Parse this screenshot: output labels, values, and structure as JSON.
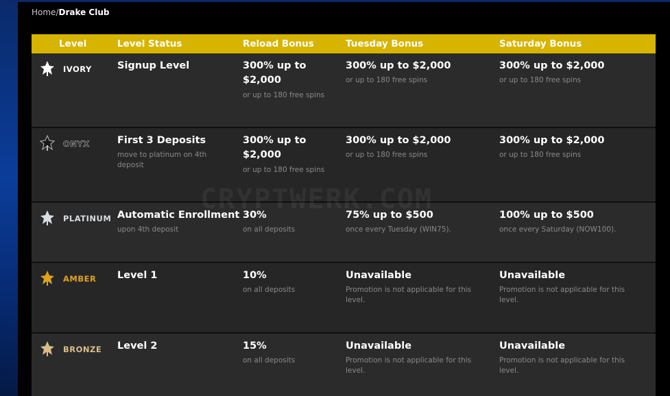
{
  "breadcrumb": {
    "home": "Home",
    "separator": "/",
    "current": "Drake Club"
  },
  "table": {
    "headers": [
      "Level",
      "Level Status",
      "Reload Bonus",
      "Tuesday Bonus",
      "Saturday Bonus"
    ],
    "rows": [
      {
        "level": "IVORY",
        "level_color": "#ffffff",
        "status": "Signup Level",
        "status_note": "",
        "reload": "300% up to\n$2,000",
        "reload_note": "or up to 180 free spins",
        "tuesday": "300% up to $2,000",
        "tuesday_note": "or up to 180 free spins",
        "saturday": "300% up to $2,000",
        "saturday_note": "or up to 180 free spins"
      },
      {
        "level": "ONYX",
        "level_color": "#1a1a1a",
        "status": "First 3 Deposits",
        "status_note": "move to platinum on 4th\ndeposit",
        "reload": "300% up to\n$2,000",
        "reload_note": "or up to 180 free spins",
        "tuesday": "300% up to $2,000",
        "tuesday_note": "or up to 180 free spins",
        "saturday": "300% up to $2,000",
        "saturday_note": "or up to 180 free spins"
      },
      {
        "level": "PLATINUM",
        "level_color": "#d9dde3",
        "status": "Automatic Enrollment",
        "status_note": "upon 4th deposit",
        "reload": "30%",
        "reload_note": "on all deposits",
        "tuesday": "75% up to $500",
        "tuesday_note": "once every Tuesday (WIN75).",
        "saturday": "100% up to $500",
        "saturday_note": "once every Saturday (NOW100)."
      },
      {
        "level": "AMBER",
        "level_color": "#e0a21a",
        "status": "Level 1",
        "status_note": "",
        "reload": "10%",
        "reload_note": "on all deposits",
        "tuesday": "Unavailable",
        "tuesday_note": "Promotion is not applicable for this\nlevel.",
        "saturday": "Unavailable",
        "saturday_note": "Promotion is not applicable for this\nlevel."
      },
      {
        "level": "BRONZE",
        "level_color": "#d8bd8a",
        "status": "Level 2",
        "status_note": "",
        "reload": "15%",
        "reload_note": "on all deposits",
        "tuesday": "Unavailable",
        "tuesday_note": "Promotion is not applicable for this\nlevel.",
        "saturday": "Unavailable",
        "saturday_note": "Promotion is not applicable for this\nlevel."
      }
    ]
  },
  "watermark": "CRYPTWERK.COM",
  "colors": {
    "header_bg": "#d6b400",
    "row_bg": "#262626",
    "page_bg": "#000000",
    "note_text": "#8a8a8a"
  }
}
